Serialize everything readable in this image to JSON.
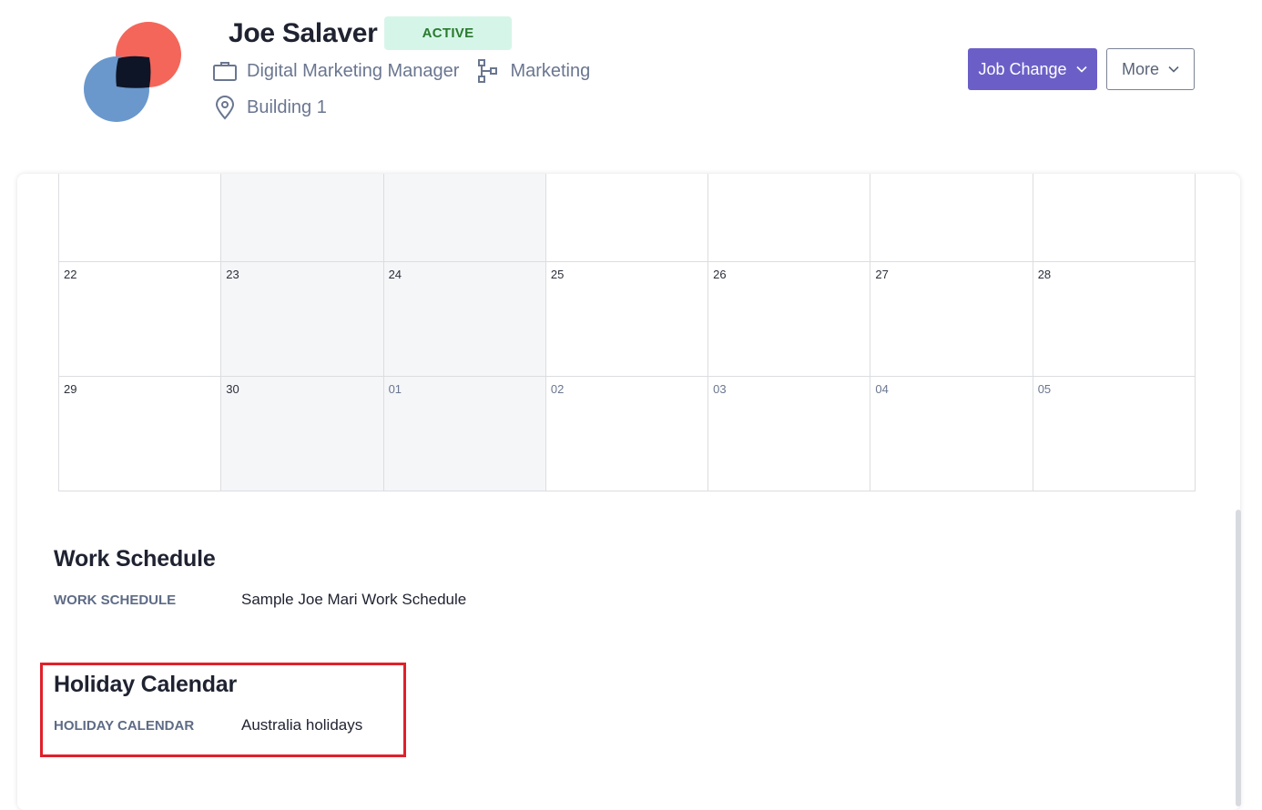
{
  "employee": {
    "name": "Joe Salaver",
    "status": "ACTIVE",
    "job_title": "Digital Marketing Manager",
    "department": "Marketing",
    "location": "Building 1"
  },
  "actions": {
    "job_change_label": "Job Change",
    "more_label": "More"
  },
  "calendar": {
    "weeks": [
      [
        "",
        "",
        "",
        "",
        "",
        "",
        ""
      ],
      [
        "22",
        "23",
        "24",
        "25",
        "26",
        "27",
        "28"
      ],
      [
        "29",
        "30",
        "01",
        "02",
        "03",
        "04",
        "05"
      ]
    ]
  },
  "work_schedule": {
    "title": "Work Schedule",
    "label": "WORK SCHEDULE",
    "value": "Sample Joe Mari Work Schedule"
  },
  "holiday_calendar": {
    "title": "Holiday Calendar",
    "label": "HOLIDAY CALENDAR",
    "value": "Australia holidays"
  },
  "colors": {
    "primary": "#6b5fc7",
    "badge_bg": "#d6f5e9",
    "badge_text": "#2a7a2e",
    "highlight": "#e0202a",
    "logo_red": "#f4665a",
    "logo_blue": "#6a98cc"
  },
  "icons": {
    "job": "briefcase-icon",
    "department": "org-chart-icon",
    "location": "map-pin-icon",
    "dropdown": "chevron-down-icon"
  }
}
